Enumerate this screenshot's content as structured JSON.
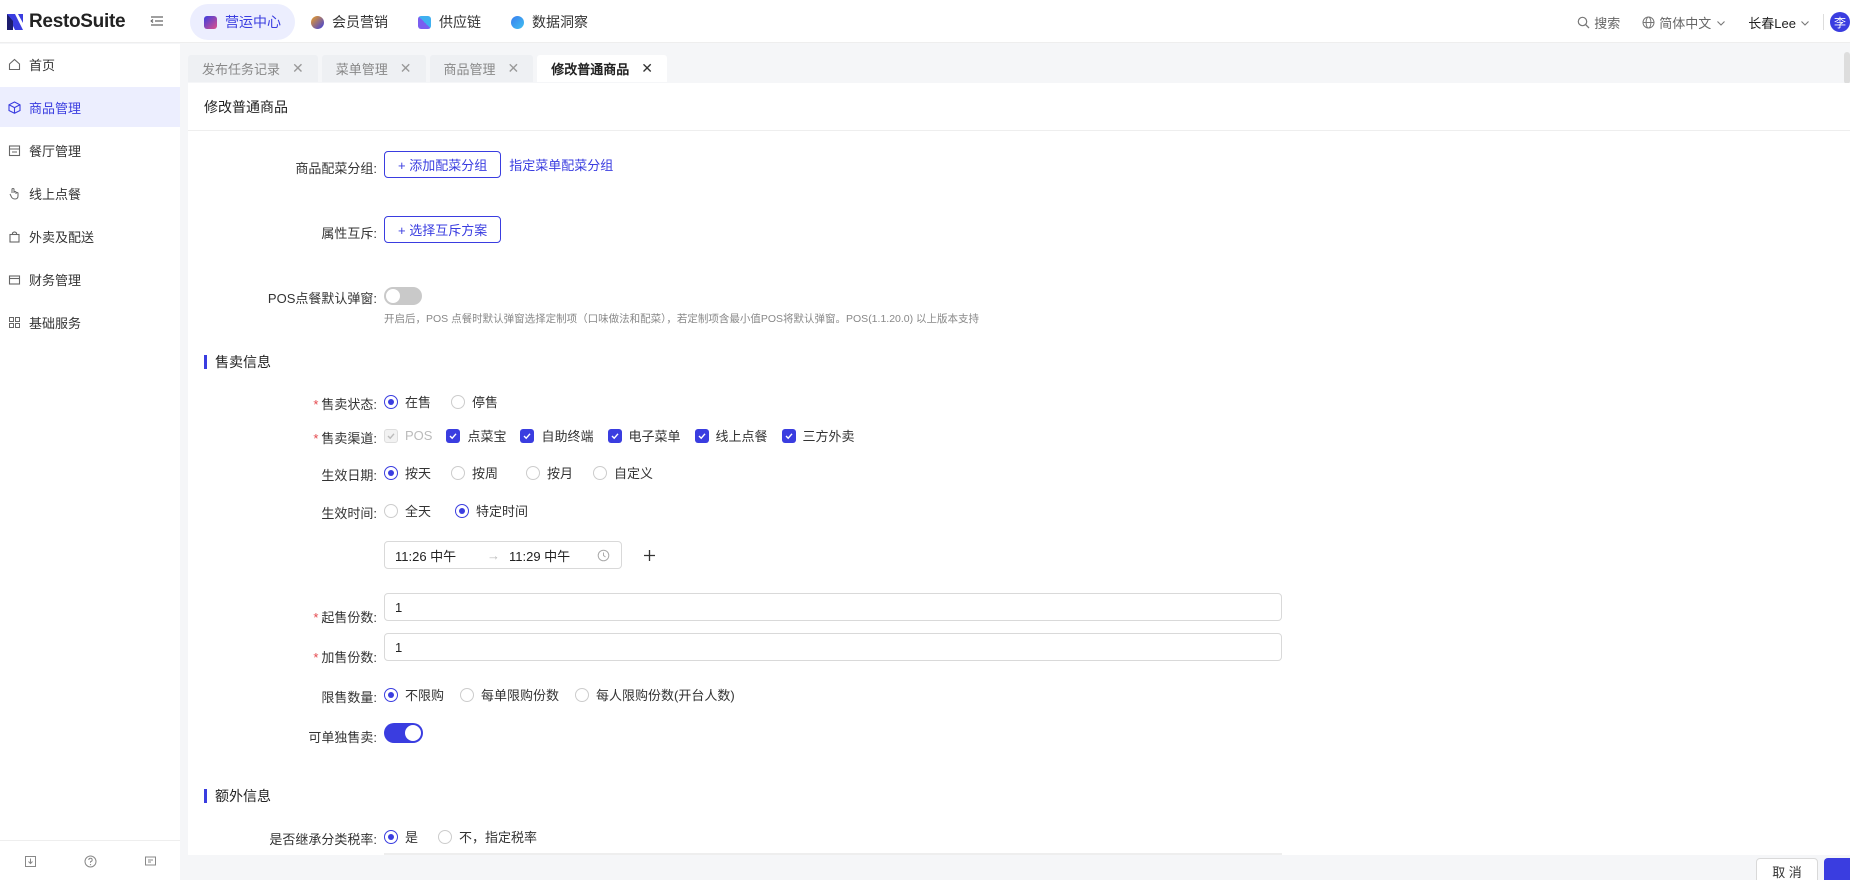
{
  "app": {
    "brand": "RestoSuite"
  },
  "topnav": [
    {
      "label": "营运中心",
      "active": true,
      "color": "#5b5ef0"
    },
    {
      "label": "会员营销",
      "active": false,
      "color": "#f0a020"
    },
    {
      "label": "供应链",
      "active": false,
      "color": "#7a5ef0"
    },
    {
      "label": "数据洞察",
      "active": false,
      "color": "#3a7ef0"
    }
  ],
  "topright": {
    "search": "搜索",
    "language": "简体中文",
    "user": "长春Lee",
    "avatar": "李"
  },
  "sidebar": {
    "items": [
      {
        "label": "首页",
        "icon": "home-icon"
      },
      {
        "label": "商品管理",
        "icon": "cube-icon",
        "active": true
      },
      {
        "label": "餐厅管理",
        "icon": "store-icon"
      },
      {
        "label": "线上点餐",
        "icon": "hand-icon"
      },
      {
        "label": "外卖及配送",
        "icon": "bag-icon"
      },
      {
        "label": "财务管理",
        "icon": "wallet-icon"
      },
      {
        "label": "基础服务",
        "icon": "grid-icon"
      }
    ]
  },
  "tabs": [
    {
      "label": "发布任务记录",
      "active": false
    },
    {
      "label": "菜单管理",
      "active": false
    },
    {
      "label": "商品管理",
      "active": false
    },
    {
      "label": "修改普通商品",
      "active": true
    }
  ],
  "page": {
    "title": "修改普通商品",
    "group_label": "商品配菜分组:",
    "group_add_button": "+ 添加配菜分组",
    "group_link": "指定菜单配菜分组",
    "exclusive_label": "属性互斥:",
    "exclusive_button": "+ 选择互斥方案",
    "pos_popup_label": "POS点餐默认弹窗:",
    "pos_popup_hint": "开启后，POS 点餐时默认弹窗选择定制项（口味做法和配菜），若定制项含最小值POS将默认弹窗。POS(1.1.20.0) 以上版本支持",
    "sale_section": "售卖信息",
    "status_label": "售卖状态:",
    "status_options": [
      "在售",
      "停售"
    ],
    "channel_label": "售卖渠道:",
    "channels": [
      "POS",
      "点菜宝",
      "自助终端",
      "电子菜单",
      "线上点餐",
      "三方外卖"
    ],
    "date_label": "生效日期:",
    "date_options": [
      "按天",
      "按周",
      "按月",
      "自定义"
    ],
    "time_label": "生效时间:",
    "time_options": [
      "全天",
      "特定时间"
    ],
    "time_start": "11:26 中午",
    "time_end": "11:29 中午",
    "min_qty_label": "起售份数:",
    "min_qty_value": "1",
    "add_qty_label": "加售份数:",
    "add_qty_value": "1",
    "limit_label": "限售数量:",
    "limit_options": [
      "不限购",
      "每单限购份数",
      "每人限购份数(开台人数)"
    ],
    "single_sale_label": "可单独售卖:",
    "extra_section": "额外信息",
    "tax_label": "是否继承分类税率:",
    "tax_options": [
      "是",
      "不，指定税率"
    ],
    "cancel_button": "取 消"
  }
}
